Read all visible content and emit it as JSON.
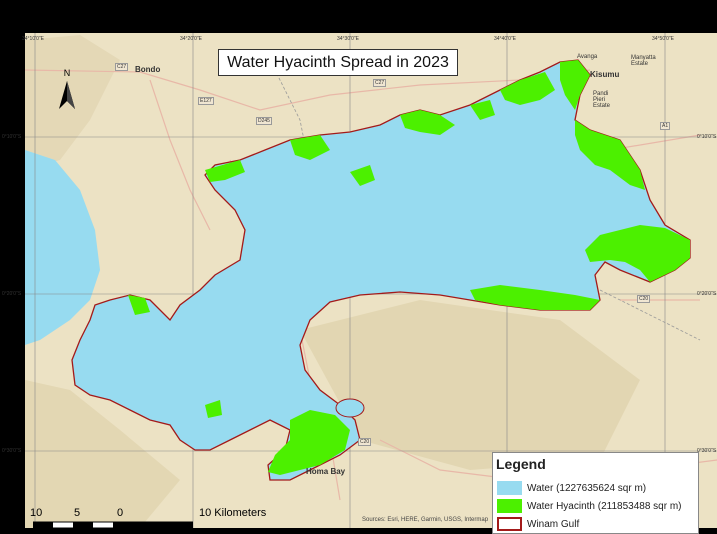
{
  "title": "Water Hyacinth Spread in 2023",
  "legend": {
    "title": "Legend",
    "items": [
      {
        "label": "Water (1227635624 sqr m)",
        "color": "#97dbf0",
        "border": "#97dbf0"
      },
      {
        "label": "Water Hyacinth (211853488 sqr m)",
        "color": "#4cf000",
        "border": "#4cf000"
      },
      {
        "label": "Winam  Gulf",
        "color": "#ffffff",
        "border": "#a31a1a"
      }
    ]
  },
  "scale": {
    "ticks": [
      "10",
      "5",
      "0",
      "10 Kilometers"
    ]
  },
  "north": "N",
  "graticule": {
    "top": [
      "34°10'0\"E",
      "34°20'0\"E",
      "34°30'0\"E",
      "34°40'0\"E",
      "34°50'0\"E"
    ],
    "left": [
      "0°10'0\"S",
      "0°20'0\"S",
      "0°30'0\"S"
    ],
    "right": [
      "0°10'0\"S",
      "0°20'0\"S",
      "0°30'0\"S"
    ]
  },
  "places": {
    "bondo": "Bondo",
    "kisumu": "Kisumu",
    "avanga": "Avanga",
    "manyatta": "Manyatta Estate",
    "pandi": "Pandi Pieri Estate",
    "homa_bay": "Homa Bay"
  },
  "roads": [
    "C27",
    "E127",
    "D245",
    "C27",
    "C20",
    "A1",
    "C20"
  ],
  "attribution": "Sources: Esri, HERE, Garmin, USGS, Intermap",
  "colors": {
    "terrain": "#ece2c4",
    "water": "#97dbf0",
    "hyacinth": "#4cf000",
    "outline": "#a31a1a"
  }
}
